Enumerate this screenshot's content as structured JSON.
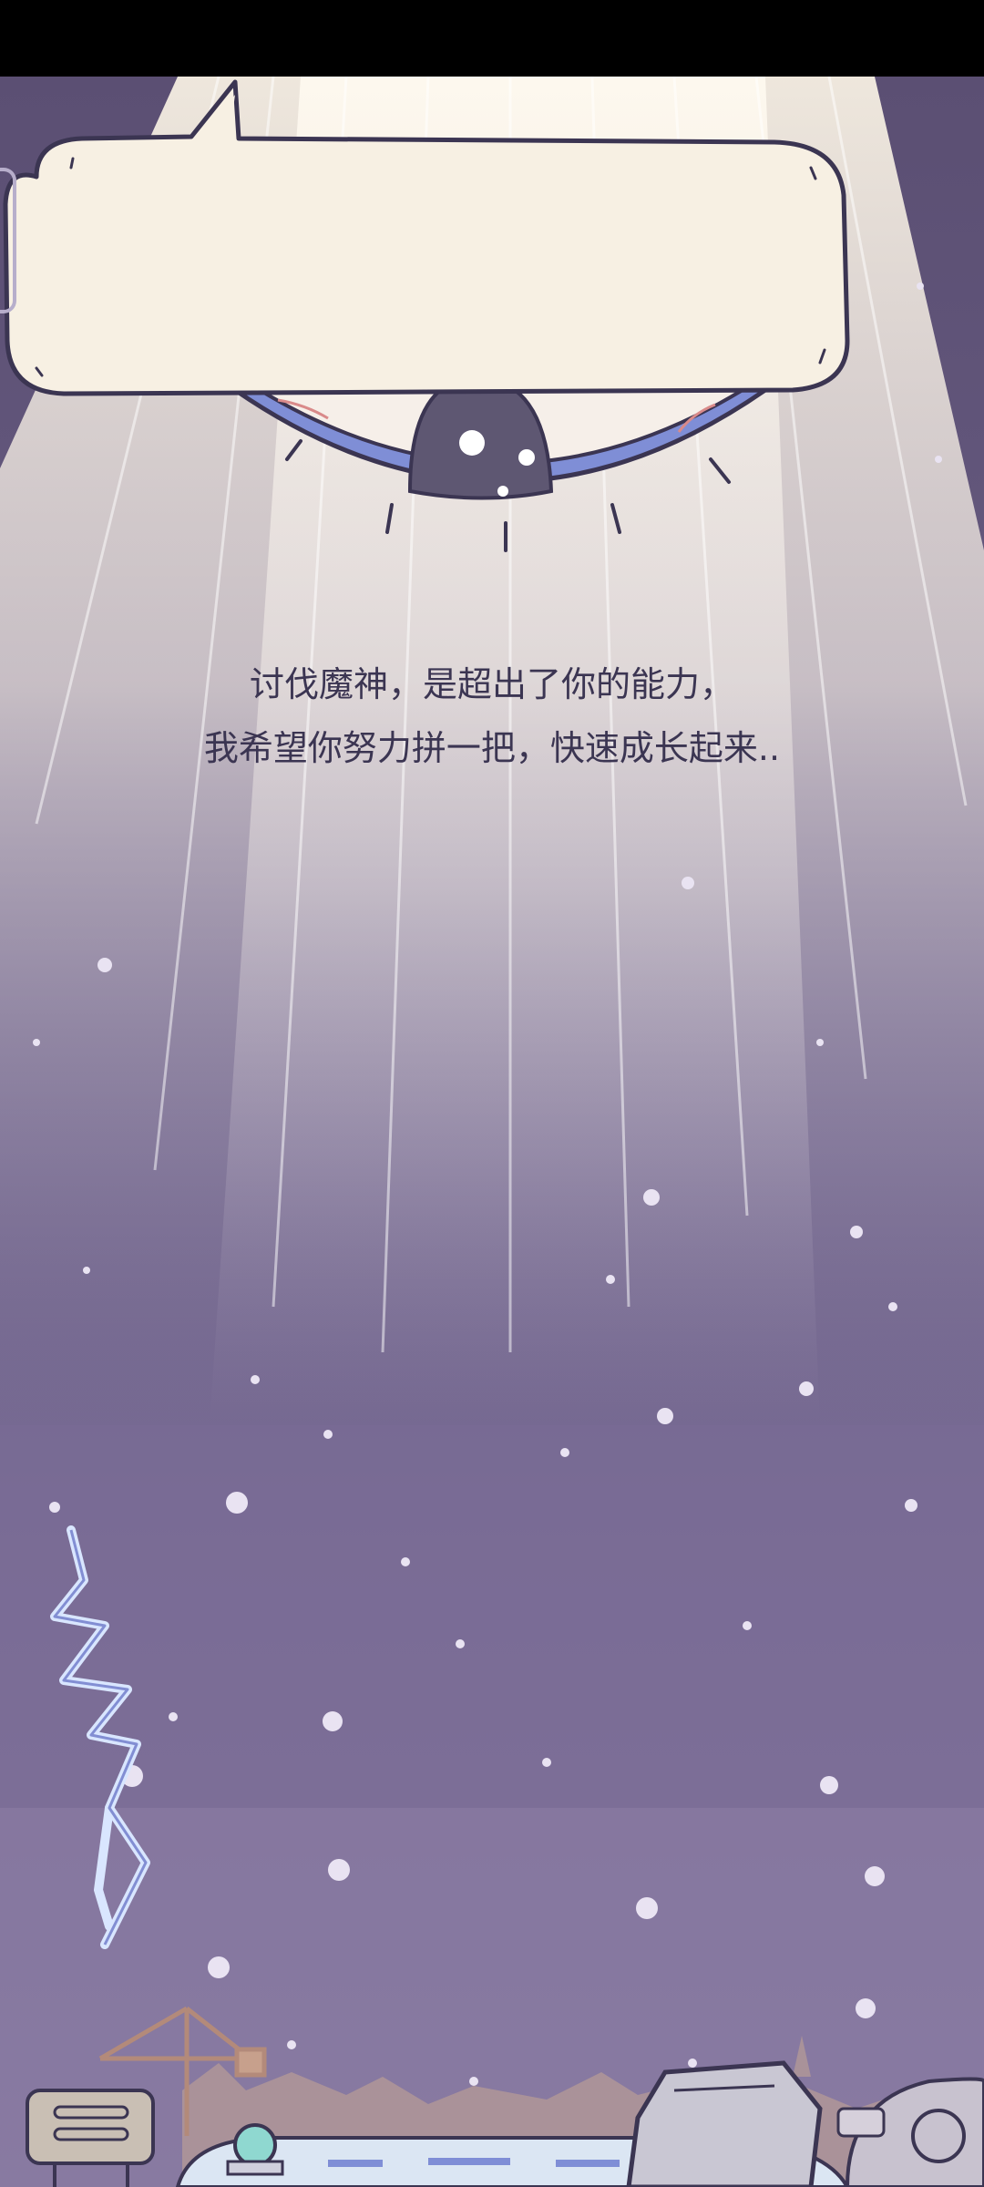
{
  "dialogue": {
    "line1": "讨伐魔神，是超出了你的能力，",
    "line2": "我希望你努力拼一把，快速成长起来.."
  },
  "colors": {
    "sky": "#5b4f73",
    "light_beam": "#f3eee4",
    "bubble_fill": "#f7f0e3",
    "bubble_stroke": "#3b3552",
    "eye_rim": "#7f8ed6",
    "pupil": "#5e5772",
    "lightning": "#d9e6ff"
  },
  "icons": {
    "eye": "giant-eye-icon",
    "lightning": "lightning-icon",
    "sign": "signboard-icon",
    "crane": "crane-icon",
    "rock": "rock-icon",
    "snail": "snail-shell-icon"
  }
}
